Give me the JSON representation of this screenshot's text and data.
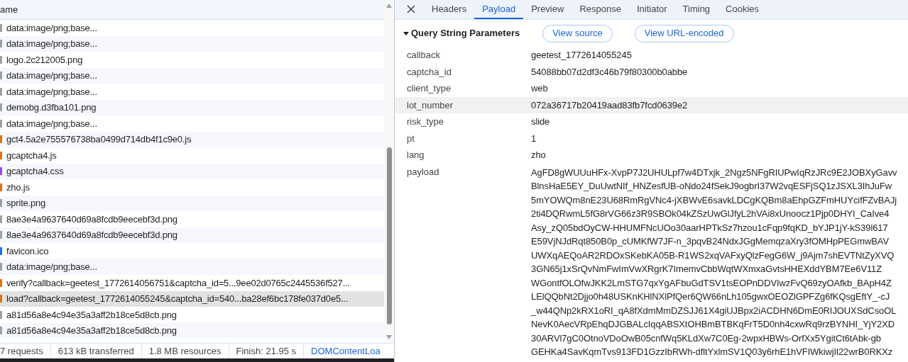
{
  "requests": {
    "column_header": "ame",
    "rows": [
      {
        "name": "data:image/png;base...",
        "kind": "image",
        "selected": false
      },
      {
        "name": "data:image/png;base...",
        "kind": "image",
        "selected": false
      },
      {
        "name": "logo.2c212005.png",
        "kind": "image",
        "selected": false
      },
      {
        "name": "data:image/png;base...",
        "kind": "image",
        "selected": false
      },
      {
        "name": "data:image/png;base...",
        "kind": "image",
        "selected": false
      },
      {
        "name": "demobg.d3fba101.png",
        "kind": "image",
        "selected": false
      },
      {
        "name": "data:image/png;base...",
        "kind": "image",
        "selected": false
      },
      {
        "name": "gct4.5a2e755576738ba0499d714db4f1c9e0.js",
        "kind": "script",
        "selected": false
      },
      {
        "name": "gcaptcha4.js",
        "kind": "script",
        "selected": false
      },
      {
        "name": "gcaptcha4.css",
        "kind": "stylesheet",
        "selected": false
      },
      {
        "name": "zho.js",
        "kind": "script",
        "selected": false
      },
      {
        "name": "sprite.png",
        "kind": "image",
        "selected": false
      },
      {
        "name": "8ae3e4a9637640d69a8fcdb9eecebf3d.png",
        "kind": "image",
        "selected": false
      },
      {
        "name": "8ae3e4a9637640d69a8fcdb9eecebf3d.png",
        "kind": "image",
        "selected": false
      },
      {
        "name": "favicon.ico",
        "kind": "icon",
        "selected": false
      },
      {
        "name": "data:image/png;base...",
        "kind": "image",
        "selected": false
      },
      {
        "name": "verify?callback=geetest_1772614056751&captcha_id=5...9ee02d0765c2445536f527...",
        "kind": "script",
        "selected": false
      },
      {
        "name": "load?callback=geetest_1772614055245&captcha_id=540...ba28ef6bc178fe037d0e5...",
        "kind": "script",
        "selected": true
      },
      {
        "name": "a81d56a8e4c94e35a3aff2b18ce5d8cb.png",
        "kind": "image",
        "selected": false
      },
      {
        "name": "a81d56a8e4c94e35a3aff2b18ce5d8cb.png",
        "kind": "image",
        "selected": false
      }
    ]
  },
  "status_bar": [
    "7 requests",
    "613 kB transferred",
    "1.8 MB resources",
    "Finish: 21.95 s"
  ],
  "status_link": "DOMContentLoa",
  "detail": {
    "tabs": [
      {
        "label": "Headers",
        "selected": false
      },
      {
        "label": "Payload",
        "selected": true
      },
      {
        "label": "Preview",
        "selected": false
      },
      {
        "label": "Response",
        "selected": false
      },
      {
        "label": "Initiator",
        "selected": false
      },
      {
        "label": "Timing",
        "selected": false
      },
      {
        "label": "Cookies",
        "selected": false
      }
    ],
    "section": {
      "title": "Query String Parameters",
      "expanded": true,
      "buttons": [
        "View source",
        "View URL-encoded"
      ]
    },
    "params": [
      {
        "name": "callback",
        "value": [
          "geetest_1772614055245"
        ],
        "highlighted": false
      },
      {
        "name": "captcha_id",
        "value": [
          "54088bb07d2df3c46b79f80300b0abbe"
        ],
        "highlighted": false
      },
      {
        "name": "client_type",
        "value": [
          "web"
        ],
        "highlighted": false
      },
      {
        "name": "lot_number",
        "value": [
          "072a36717b20419aad83fb7fcd0639e2"
        ],
        "highlighted": true
      },
      {
        "name": "risk_type",
        "value": [
          "slide"
        ],
        "highlighted": false
      },
      {
        "name": "pt",
        "value": [
          "1"
        ],
        "highlighted": false
      },
      {
        "name": "lang",
        "value": [
          "zho"
        ],
        "highlighted": false
      },
      {
        "name": "payload",
        "value": [
          "AgFD8gWUUuHFx-XvpP7J2UHULpf7w4DTxjk_2Ngz5NFgRIUPwIqRzJRc9E2JOBXyGavv",
          "BlnsHaE5EY_DuUwtNIf_HNZesfUB-oNdo24fSekJ9ogbrI37W2vqESFjSQ1zJSXL3IhJuFw",
          "5mYOWQm8nE23U68RmRgVNc4-jXBWvE6savkLDCgKQBm8aEhpGZFmHUYcifFZvBAJj",
          "2ti4DQRwmL5fG8rVG66z3R9SBOk04kZSzUwGlJfyL2hVAi8xUnoocz1Pjp0DHYI_CaIve4",
          "Asy_zQ05bdOyCW-HHUMFNcUOo30aarHPTkSz7hzou1cFqp9fqKD_bYJP1jY-kS39l617",
          "E59VjNJdRqt850B0p_cUMKfW7JF-n_3pqvB24NdxJGgMemqzaXry3fOMHpPEGmwBAV",
          "UWXqAEQoAR2RDOxSKebKA05B-R1WS2xqVAFxyQlzFegG6W_j9Ajm7shEVTNtZyXVQ",
          "3GN65j1xSrQvNmFwImVwXRgrK7ImemvCbbWqtWXmxaGvtsHHEXddYBM7Ee6V11Z",
          "WGontfOLOfwJKK2LmSTG7qxYgAFbuGdTSV1tsEOPnDDVIwzFvQ69zyOAfkb_BApH4Z",
          "LElQQbNt2Djjo0h48USKnKHlNXlPfQer6QW66nLh105gwxOEOZlGPFZg6fKQsgEftY_-cJ",
          "_w44QNp2kRX1oRI_qA8fXdmMmDZSJJ61X4giUJBpx2iACDHN6DmE0RIJOUXSdCsoOL",
          "NevK0AecVRpEhqDJGBALcIqqABSXtOHBmBTBKqFrT5D0nh4cxwRq9rzBYNHI_YjY2XD",
          "30ARVl7gC0OtnoVDoOwB05cnfWq5KLdXw7C0Eg-2wpxHBWs-OrfXx5YgitCt6tAbk-gb",
          "GEHKa4SavKqmTvs913FD1GzzIbRWh-dfltYxlmSV1Q03y6rhE1hVFIWkiwjIl22wrB0RKXz"
        ],
        "highlighted": false
      }
    ]
  }
}
